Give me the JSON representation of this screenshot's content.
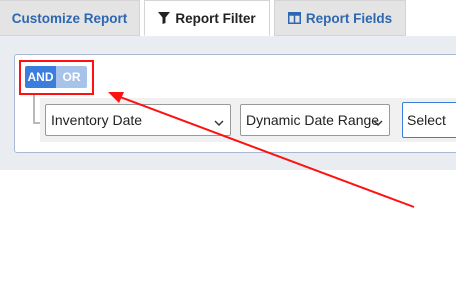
{
  "tabs": [
    {
      "label": "Customize Report",
      "icon": ""
    },
    {
      "label": "Report Filter",
      "icon": "filter-icon"
    },
    {
      "label": "Report Fields",
      "icon": "columns-icon"
    }
  ],
  "filter": {
    "logic": {
      "and_label": "AND",
      "or_label": "OR",
      "selected": "AND"
    },
    "field_select": "Inventory Date",
    "operator_select": "Dynamic Date Range",
    "value_select": "Select"
  },
  "colors": {
    "accent": "#3b7ddd",
    "tab_text": "#2e67b1",
    "annotation": "#ff1111"
  }
}
